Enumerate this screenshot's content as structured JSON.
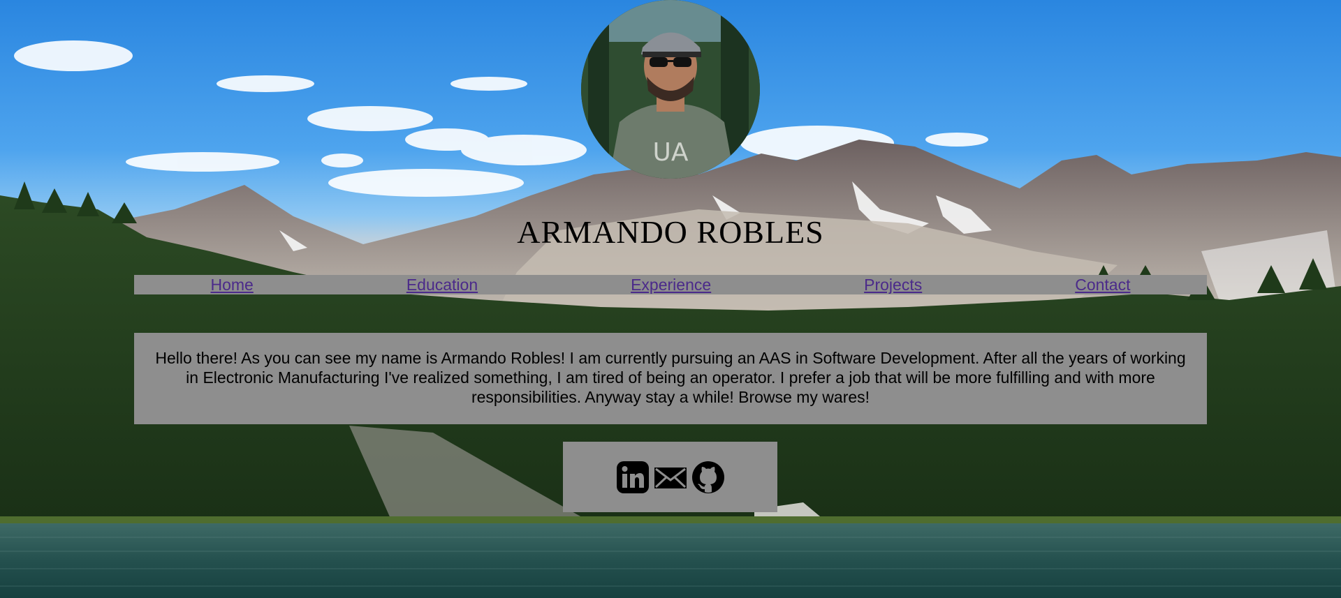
{
  "profile": {
    "name": "ARMANDO ROBLES",
    "avatar_icon": "profile-photo"
  },
  "nav": {
    "items": [
      {
        "label": "Home"
      },
      {
        "label": "Education"
      },
      {
        "label": "Experience"
      },
      {
        "label": "Projects"
      },
      {
        "label": "Contact"
      }
    ]
  },
  "intro": {
    "text": "Hello there! As you can see my name is Armando Robles! I am currently pursuing an AAS in Software Development. After all the years of working in Electronic Manufacturing I've realized something, I am tired of being an operator. I prefer a job that will be more fulfilling and with more responsibilities. Anyway stay a while! Browse my wares!"
  },
  "socials": {
    "items": [
      {
        "icon": "linkedin-icon"
      },
      {
        "icon": "email-icon"
      },
      {
        "icon": "github-icon"
      }
    ]
  },
  "colors": {
    "panel": "#8e8e8e",
    "link": "#4b2a8a",
    "sky": "#2a86e0"
  }
}
